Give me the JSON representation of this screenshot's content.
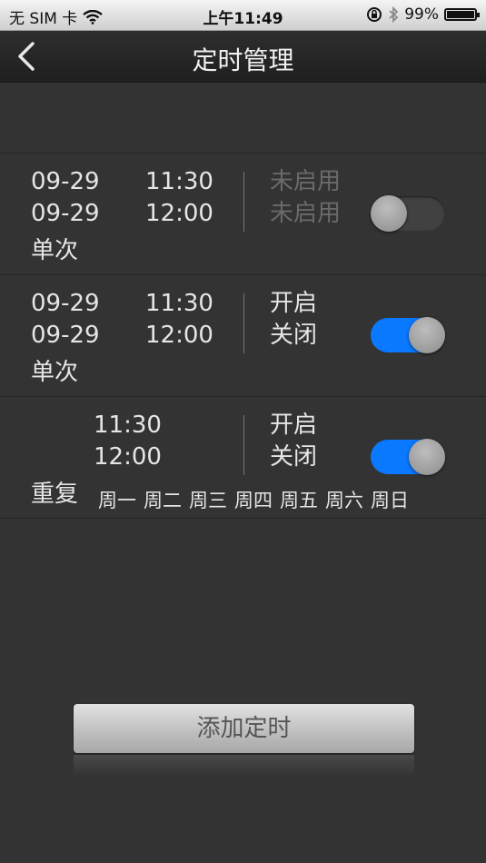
{
  "status_bar": {
    "carrier": "无 SIM 卡",
    "time": "上午11:49",
    "battery": "99%",
    "battery_level": 0.99
  },
  "nav": {
    "title": "定时管理",
    "back_icon": "chevron-left-icon"
  },
  "timers": [
    {
      "start_date": "09-29",
      "start_time": "11:30",
      "start_action": "未启用",
      "end_date": "09-29",
      "end_time": "12:00",
      "end_action": "未启用",
      "mode": "单次",
      "enabled": false
    },
    {
      "start_date": "09-29",
      "start_time": "11:30",
      "start_action": "开启",
      "end_date": "09-29",
      "end_time": "12:00",
      "end_action": "关闭",
      "mode": "单次",
      "enabled": true
    },
    {
      "start_time": "11:30",
      "start_action": "开启",
      "end_time": "12:00",
      "end_action": "关闭",
      "mode": "重复",
      "days": [
        "周一",
        "周二",
        "周三",
        "周四",
        "周五",
        "周六",
        "周日"
      ],
      "enabled": true
    }
  ],
  "add_button": {
    "label": "添加定时"
  },
  "colors": {
    "background": "#333333",
    "toggle_on": "#0a78ff",
    "toggle_off": "#414141",
    "muted_text": "#6a6a6a"
  }
}
